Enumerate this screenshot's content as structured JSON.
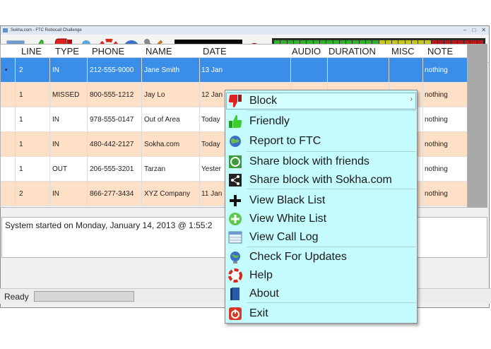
{
  "window": {
    "title": "Sokha.com - FTC Robocall Challenge"
  },
  "toolbar": {
    "timer": "00:00:00.000",
    "icons": [
      "call-log-icon",
      "thumbs-up-icon",
      "thumbs-down-icon",
      "user-icon",
      "help-ring-icon",
      "globe-icon",
      "tools-icon",
      "record-icon"
    ]
  },
  "table": {
    "columns": [
      "LINE",
      "TYPE",
      "PHONE",
      "NAME",
      "DATE",
      "AUDIO",
      "DURATION",
      "MISC",
      "NOTE"
    ],
    "rows": [
      {
        "line": "2",
        "type": "IN",
        "phone": "212-555-9000",
        "name": "Jane Smith",
        "date": "13 Jan",
        "note": "nothing",
        "selected": true
      },
      {
        "line": "1",
        "type": "MISSED",
        "phone": "800-555-1212",
        "name": "Jay Lo",
        "date": "12 Jan",
        "note": "nothing"
      },
      {
        "line": "1",
        "type": "IN",
        "phone": "978-555-0147",
        "name": "Out of Area",
        "date": "Today",
        "note": "nothing"
      },
      {
        "line": "1",
        "type": "IN",
        "phone": "480-442-2127",
        "name": "Sokha.com",
        "date": "Today",
        "note": "nothing"
      },
      {
        "line": "1",
        "type": "OUT",
        "phone": "206-555-3201",
        "name": "Tarzan",
        "date": "Yester",
        "note": "nothing"
      },
      {
        "line": "2",
        "type": "IN",
        "phone": "866-277-3434",
        "name": "XYZ Company",
        "date": "11 Jan",
        "note": "nothing"
      }
    ]
  },
  "log": {
    "text": "System started on Monday, January 14, 2013 @ 1:55:2"
  },
  "status": {
    "text": "Ready"
  },
  "context_menu": {
    "items": [
      {
        "label": "Block",
        "icon": "thumbs-down-icon",
        "arrow": "›"
      },
      {
        "label": "Friendly",
        "icon": "thumbs-up-icon"
      },
      {
        "label": "Report to FTC",
        "icon": "globe-icon"
      },
      {
        "label": "Share block with friends",
        "icon": "share-ring-icon"
      },
      {
        "label": "Share block with Sokha.com",
        "icon": "share-icon"
      },
      {
        "label": "View Black List",
        "icon": "plus-black-icon"
      },
      {
        "label": "View White List",
        "icon": "plus-green-icon"
      },
      {
        "label": "View Call Log",
        "icon": "call-log-icon"
      },
      {
        "label": "Check For Updates",
        "icon": "update-icon"
      },
      {
        "label": "Help",
        "icon": "help-ring-icon"
      },
      {
        "label": "About",
        "icon": "book-icon"
      },
      {
        "label": "Exit",
        "icon": "power-icon"
      }
    ]
  },
  "colors": {
    "selected_row": "#3b8ee8",
    "alt_row": "#fde0c5",
    "menu_bg": "#c4fcfd",
    "meter_green": "#2fb12a",
    "meter_yellow": "#c6c61a",
    "meter_red": "#b41818"
  }
}
